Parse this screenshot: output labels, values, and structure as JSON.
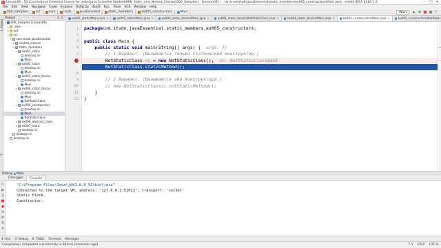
{
  "window": {
    "title": "Lesson06 - [D:\\Course\\Java Essential Course for video\\Java Essential Student\\006_Static_and_Nested_Classes\\006_Samples] - [Lesson06] - ...\\src\\com\\itvdn\\javaEssential\\static_members\\ex005_constructors\\Main.java - IntelliJ IDEA 2016.1.3"
  },
  "menu": [
    "File",
    "Edit",
    "View",
    "Navigate",
    "Code",
    "Analyze",
    "Refactor",
    "Build",
    "Run",
    "Tools",
    "VCS",
    "Window",
    "Help"
  ],
  "breadcrumbs": [
    "006_Samples",
    "src",
    "com",
    "itvdn",
    "javaEssential",
    "static_members",
    "ex005_constructors",
    "Main"
  ],
  "toolbar": {
    "run_config": "Main"
  },
  "left_tabs": [
    "1: Project",
    "7: Structure"
  ],
  "project_panel": {
    "header": "Project",
    "tree": [
      {
        "label": "006_Samples (Lesson06)",
        "depth": 0,
        "icon": "mod",
        "arrow": "▾"
      },
      {
        "label": ".idea",
        "depth": 1,
        "icon": "folder",
        "arrow": "▸"
      },
      {
        "label": "out",
        "depth": 1,
        "icon": "folder",
        "arrow": "▸"
      },
      {
        "label": "src",
        "depth": 1,
        "icon": "folder",
        "arrow": "▾"
      },
      {
        "label": "com.itvdn.javaEssential",
        "depth": 2,
        "icon": "pkg",
        "arrow": "▾"
      },
      {
        "label": "nested_classes",
        "depth": 3,
        "icon": "pkg",
        "arrow": "▸"
      },
      {
        "label": "static_members",
        "depth": 3,
        "icon": "pkg",
        "arrow": "▾"
      },
      {
        "label": "ex001_static",
        "depth": 4,
        "icon": "pkg",
        "arrow": "▾"
      },
      {
        "label": "desktop.ini",
        "depth": 5,
        "icon": "file",
        "arrow": ""
      },
      {
        "label": "Main",
        "depth": 5,
        "icon": "cls",
        "arrow": ""
      },
      {
        "label": "ex002_static",
        "depth": 4,
        "icon": "pkg",
        "arrow": "▾"
      },
      {
        "label": "desktop.ini",
        "depth": 5,
        "icon": "file",
        "arrow": ""
      },
      {
        "label": "Main",
        "depth": 5,
        "icon": "cls",
        "arrow": ""
      },
      {
        "label": "ex003_static_blocks",
        "depth": 4,
        "icon": "pkg",
        "arrow": "▾"
      },
      {
        "label": "desktop.ini",
        "depth": 5,
        "icon": "file",
        "arrow": ""
      },
      {
        "label": "Main",
        "depth": 5,
        "icon": "cls",
        "arrow": ""
      },
      {
        "label": "ex004_static_blocks",
        "depth": 4,
        "icon": "pkg",
        "arrow": "▾"
      },
      {
        "label": "desktop.ini",
        "depth": 5,
        "icon": "file",
        "arrow": ""
      },
      {
        "label": "Main",
        "depth": 5,
        "icon": "cls",
        "arrow": ""
      },
      {
        "label": "NotStaticClass",
        "depth": 5,
        "icon": "cls",
        "arrow": ""
      },
      {
        "label": "ex005_constructors",
        "depth": 4,
        "icon": "pkg",
        "arrow": "▾"
      },
      {
        "label": "desktop.ini",
        "depth": 5,
        "icon": "file",
        "arrow": ""
      },
      {
        "label": "Main",
        "depth": 5,
        "icon": "cls",
        "arrow": "",
        "selected": true
      },
      {
        "label": "NotStaticClass",
        "depth": 5,
        "icon": "cls",
        "arrow": ""
      },
      {
        "label": "ex006_abstract_class",
        "depth": 4,
        "icon": "pkg",
        "arrow": "▸"
      },
      {
        "label": "ex007_static",
        "depth": 4,
        "icon": "pkg",
        "arrow": "▸"
      },
      {
        "label": "desktop.ini",
        "depth": 4,
        "icon": "file",
        "arrow": ""
      },
      {
        "label": "desktop.ini",
        "depth": 2,
        "icon": "file",
        "arrow": ""
      },
      {
        "label": "desktop.ini",
        "depth": 1,
        "icon": "file",
        "arrow": ""
      }
    ]
  },
  "editor_tabs": [
    {
      "label": "ex001_static\\Main.java",
      "active": false
    },
    {
      "label": "ex002_static\\Main.java",
      "active": false
    },
    {
      "label": "ex003_static_blocks\\Main.java",
      "active": false
    },
    {
      "label": "ex004_static_blocks\\NotStaticClass.java",
      "active": false
    },
    {
      "label": "ex004_static_blocks\\Main.java",
      "active": false
    },
    {
      "label": "ex005_constructors\\Main.java",
      "active": true
    },
    {
      "label": "ex005_constructors\\NotStaticClass.java",
      "active": false
    }
  ],
  "code": {
    "lines": [
      {
        "n": "1",
        "parts": [
          [
            "kw",
            "package"
          ],
          [
            "",
            "com.itvdn.javaEssential.static_members.ex005_constructors;"
          ]
        ]
      },
      {
        "n": "2",
        "parts": []
      },
      {
        "n": "3",
        "parts": [
          [
            "kw",
            "public class "
          ],
          [
            "",
            "Main {"
          ]
        ]
      },
      {
        "n": "4",
        "parts": [
          [
            "",
            "    "
          ],
          [
            "kw",
            "public static void "
          ],
          [
            "",
            "main(String[] args) {  "
          ],
          [
            "hint",
            "args: {}"
          ]
        ]
      },
      {
        "n": "5",
        "parts": [
          [
            "",
            "        "
          ],
          [
            "cm",
            "// 1 Вариант. (Вызывается только Статический конструктор.)"
          ]
        ]
      },
      {
        "n": "6",
        "parts": [
          [
            "",
            "        NotStaticClass "
          ],
          [
            "hint",
            "nc"
          ],
          [
            "",
            " = "
          ],
          [
            "kw",
            "new "
          ],
          [
            "",
            "NotStaticClass();  "
          ],
          [
            "hint",
            "nc: NotStaticClass@459"
          ]
        ],
        "row": "bp"
      },
      {
        "n": "7",
        "parts": [
          [
            "",
            "        NotStaticClass."
          ],
          [
            "it",
            "staticMethod"
          ],
          [
            "",
            "();"
          ]
        ],
        "row": "cur"
      },
      {
        "n": "8",
        "parts": []
      },
      {
        "n": "9",
        "parts": [
          [
            "",
            "        "
          ],
          [
            "cm",
            "// 2 Вариант. (Вызываются оба Конструктора.)"
          ]
        ]
      },
      {
        "n": "10",
        "parts": [
          [
            "",
            "        "
          ],
          [
            "cm",
            "// new NotStaticClass().notStaticMethod();"
          ]
        ]
      },
      {
        "n": "11",
        "parts": [
          [
            "",
            "    }"
          ]
        ]
      },
      {
        "n": "12",
        "parts": [
          [
            "",
            "}"
          ]
        ]
      }
    ]
  },
  "debug": {
    "header_label": "Debug",
    "config_name": "Main",
    "tabs": [
      "Debugger",
      "Console"
    ],
    "console_lines": [
      "\"C:\\Program Files\\Java\\jdk1.8.0_92\\bin\\java\" ...",
      "Connected to the target VM, address: '127.0.0.1:51023', transport: 'socket'",
      "Static block.",
      "Constructor."
    ]
  },
  "bottom_tabs": [
    "4: Run",
    "5: Debug",
    "6: TODO",
    "Terminal",
    "Messages"
  ],
  "status": {
    "message": "Compilation completed successfully in 843ms (moments ago)",
    "position": "7:1",
    "line_sep": "CRLF",
    "encoding": "UTF-8"
  }
}
